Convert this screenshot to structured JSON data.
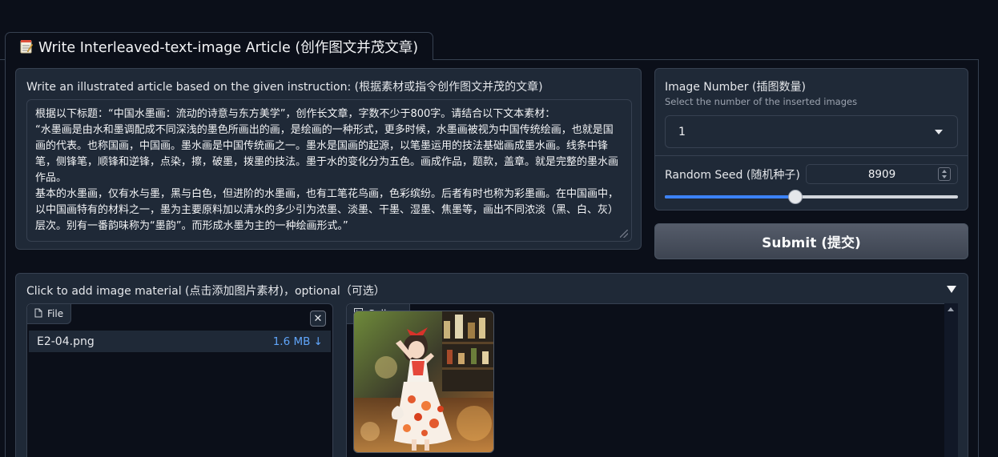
{
  "tab": {
    "icon": "memo-icon",
    "label": "Write Interleaved-text-image Article (创作图文并茂文章)"
  },
  "instruction": {
    "label": "Write an illustrated article based on the given instruction: (根据素材或指令创作图文并茂的文章)",
    "value": "根据以下标题：“中国水墨画：流动的诗意与东方美学”，创作长文章，字数不少于800字。请结合以下文本素材：\n“水墨画是由水和墨调配成不同深浅的墨色所画出的画，是绘画的一种形式，更多时候，水墨画被视为中国传统绘画，也就是国画的代表。也称国画，中国画。墨水画是中国传统画之一。墨水是国画的起源，以笔墨运用的技法基础画成墨水画。线条中锋笔，侧锋笔，顺锋和逆锋，点染，擦，破墨，拨墨的技法。墨于水的变化分为五色。画成作品，题款，盖章。就是完整的墨水画作品。\n基本的水墨画，仅有水与墨，黑与白色，但进阶的水墨画，也有工笔花鸟画，色彩缤纷。后者有时也称为彩墨画。在中国画中，以中国画特有的材料之一，墨为主要原料加以清水的多少引为浓墨、淡墨、干墨、湿墨、焦墨等，画出不同浓淡（黑、白、灰）层次。别有一番韵味称为“墨韵”。而形成水墨为主的一种绘画形式。”"
  },
  "image_number": {
    "label": "Image Number (插图数量)",
    "info": "Select the number of the inserted images",
    "selected": "1"
  },
  "random_seed": {
    "label": "Random Seed (随机种子)",
    "value": "8909",
    "slider_fraction": 0.445
  },
  "submit": {
    "label": "Submit (提交)"
  },
  "accordion": {
    "title": "Click to add image material (点击添加图片素材)，optional（可选）",
    "file_panel": {
      "badge": "File",
      "file_name": "E2-04.png",
      "file_size": "1.6 MB ↓"
    },
    "gallery_panel": {
      "badge": "Gallery"
    }
  }
}
